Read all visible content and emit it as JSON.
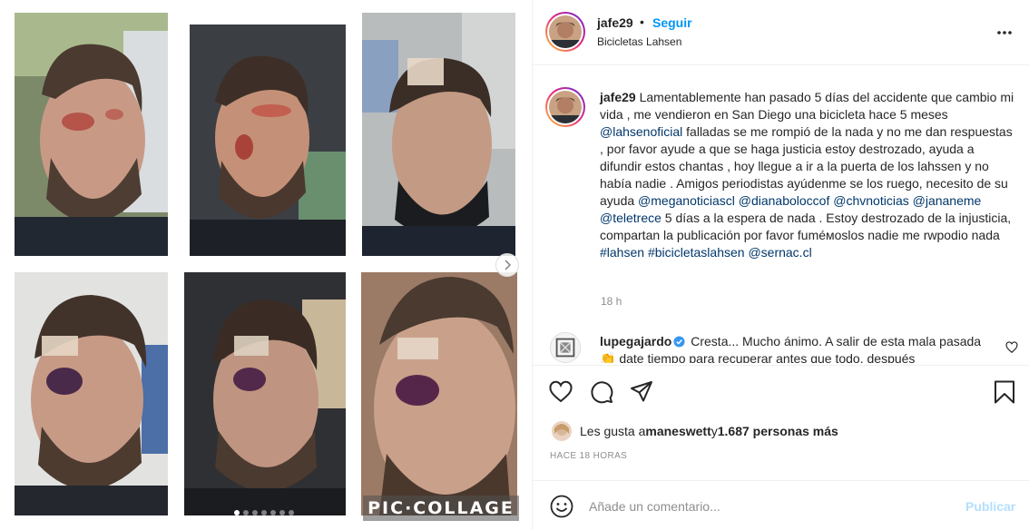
{
  "post": {
    "username": "jafe29",
    "separator": "•",
    "follow_label": "Seguir",
    "location": "Bicicletas Lahsen",
    "more_icon": "more-horizontal-icon"
  },
  "caption": {
    "username": "jafe29",
    "t1": " Lamentablemente han pasado 5 días del accidente que cambio mi vida , me vendieron en San Diego una bicicleta hace 5 meses ",
    "m1": "@lahsenoficial",
    "t2": " falladas se me rompió de la nada y no me dan respuestas , por favor ayude a que se haga justicia estoy destrozado, ayuda a difundir estos chantas , hoy llegue a ir a la puerta de los lahssen y no había nadie . Amigos periodistas ayúdenme se los ruego, necesito de su ayuda ",
    "m2": "@meganoticiascl",
    "t3": " ",
    "m3": "@dianaboloccof",
    "t4": " ",
    "m4": "@chvnoticias",
    "t5": " ",
    "m5": "@jananeme",
    "t6": " ",
    "m6": "@teletrece",
    "t7": " 5 días a la espera de nada . Estoy destrozado de la injusticia, compartan la publicación por favor fuméмoslos nadie me rwpodio nada ",
    "m7": "#lahsen",
    "t8": " ",
    "m8": "#bicicletaslahsen",
    "t9": " ",
    "m9": "@sernac.cl",
    "time": "18 h"
  },
  "comment": {
    "username": "lupegajardo",
    "text": " Cresta... Mucho ánimo. A salir de esta mala pasada 👏 date tiempo para recuperar antes que todo, después"
  },
  "likes": {
    "prefix": "Les gusta a ",
    "user": "maneswett",
    "middle": " y ",
    "count": "1.687 personas más"
  },
  "post_time": "HACE 18 HORAS",
  "add_comment": {
    "placeholder": "Añade un comentario...",
    "publish_label": "Publicar"
  },
  "media": {
    "watermark": "PIC·COLLAGE",
    "carousel_count": 7,
    "carousel_active": 0
  },
  "colors": {
    "accent": "#0095f6",
    "link": "#00376b",
    "muted": "#8e8e8e",
    "publish_disabled": "#b2dffc"
  }
}
